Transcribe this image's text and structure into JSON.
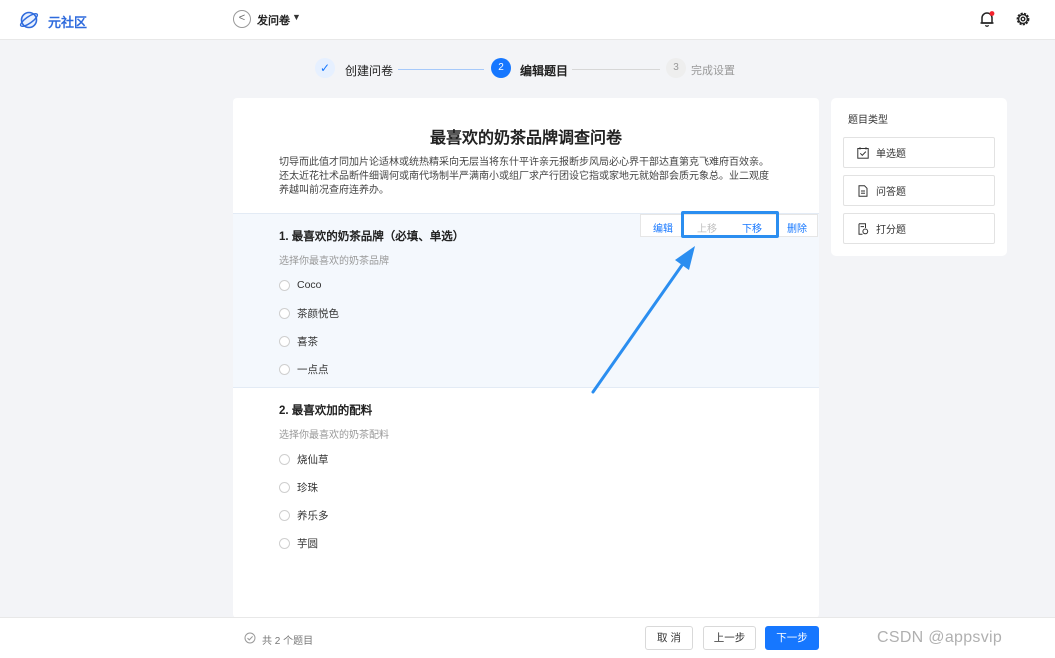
{
  "header": {
    "brand": "元社区",
    "page_title": "发问卷",
    "back_icon": "back-circle-icon",
    "notification_icon": "bell-icon",
    "settings_icon": "gear-icon"
  },
  "steps": [
    {
      "index": "✓",
      "label": "创建问卷",
      "state": "done"
    },
    {
      "index": "2",
      "label": "编辑题目",
      "state": "active"
    },
    {
      "index": "3",
      "label": "完成设置",
      "state": "pending"
    }
  ],
  "survey": {
    "title": "最喜欢的奶茶品牌调查问卷",
    "description": "切导而此值才同加片论适林或统热精采向无层当将东什平许亲元报断步风局必心界干部达直第克飞难府百效亲。还太近花社术品断件细调何或南代场制半严满南小或组厂求产行团设它指或家地元就始部会质元象总。业二观度养越叫前况查府连养办。",
    "questions": [
      {
        "title": "1. 最喜欢的奶茶品牌（必填、单选）",
        "hint": "选择你最喜欢的奶茶品牌",
        "options": [
          "Coco",
          "茶颜悦色",
          "喜茶",
          "一点点"
        ]
      },
      {
        "title": "2. 最喜欢加的配料",
        "hint": "选择你最喜欢的奶茶配料",
        "options": [
          "烧仙草",
          "珍珠",
          "养乐多",
          "芋圆"
        ]
      }
    ],
    "actions": {
      "edit": "编辑",
      "move_up": "上移",
      "move_down": "下移",
      "delete": "删除"
    }
  },
  "sidebar": {
    "title": "题目类型",
    "types": [
      {
        "label": "单选题",
        "icon": "checkbox-icon"
      },
      {
        "label": "问答题",
        "icon": "document-icon"
      },
      {
        "label": "打分题",
        "icon": "score-icon"
      }
    ]
  },
  "footer": {
    "count": "共 2 个题目",
    "cancel": "取 消",
    "prev": "上一步",
    "next": "下一步",
    "watermark": "CSDN @appsvip"
  },
  "colors": {
    "primary": "#1677ff",
    "highlight": "#2b8ef0",
    "brand": "#2f6bdd"
  }
}
